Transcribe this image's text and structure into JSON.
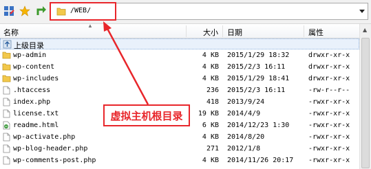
{
  "toolbar": {
    "path": "/WEB/",
    "icons": [
      "grid-icon",
      "star-icon",
      "up-arrow-icon",
      "folder-icon",
      "dropdown-arrow-icon"
    ]
  },
  "columns": {
    "name": "名称",
    "size": "大小",
    "date": "日期",
    "attr": "属性"
  },
  "parent_dir": "上级目录",
  "files": [
    {
      "name": "wp-admin",
      "size": "4 KB",
      "date": "2015/1/29 18:32",
      "attr": "drwxr-xr-x",
      "type": "folder"
    },
    {
      "name": "wp-content",
      "size": "4 KB",
      "date": "2015/2/3 16:11",
      "attr": "drwxr-xr-x",
      "type": "folder"
    },
    {
      "name": "wp-includes",
      "size": "4 KB",
      "date": "2015/1/29 18:41",
      "attr": "drwxr-xr-x",
      "type": "folder"
    },
    {
      "name": ".htaccess",
      "size": "236",
      "date": "2015/2/3 16:11",
      "attr": "-rw-r--r--",
      "type": "file"
    },
    {
      "name": "index.php",
      "size": "418",
      "date": "2013/9/24",
      "attr": "-rwxr-xr-x",
      "type": "file"
    },
    {
      "name": "license.txt",
      "size": "19 KB",
      "date": "2014/4/9",
      "attr": "-rwxr-xr-x",
      "type": "file"
    },
    {
      "name": "readme.html",
      "size": "6 KB",
      "date": "2014/12/23 1:30",
      "attr": "-rwxr-xr-x",
      "type": "html"
    },
    {
      "name": "wp-activate.php",
      "size": "4 KB",
      "date": "2014/8/20",
      "attr": "-rwxr-xr-x",
      "type": "file"
    },
    {
      "name": "wp-blog-header.php",
      "size": "271",
      "date": "2012/1/8",
      "attr": "-rwxr-xr-x",
      "type": "file"
    },
    {
      "name": "wp-comments-post.php",
      "size": "4 KB",
      "date": "2014/11/26 20:17",
      "attr": "-rwxr-xr-x",
      "type": "file"
    }
  ],
  "annotation": "虚拟主机根目录",
  "colors": {
    "annotation_red": "#e8262b",
    "folder_yellow": "#f2c84b",
    "selection": "#e9f1fb"
  }
}
